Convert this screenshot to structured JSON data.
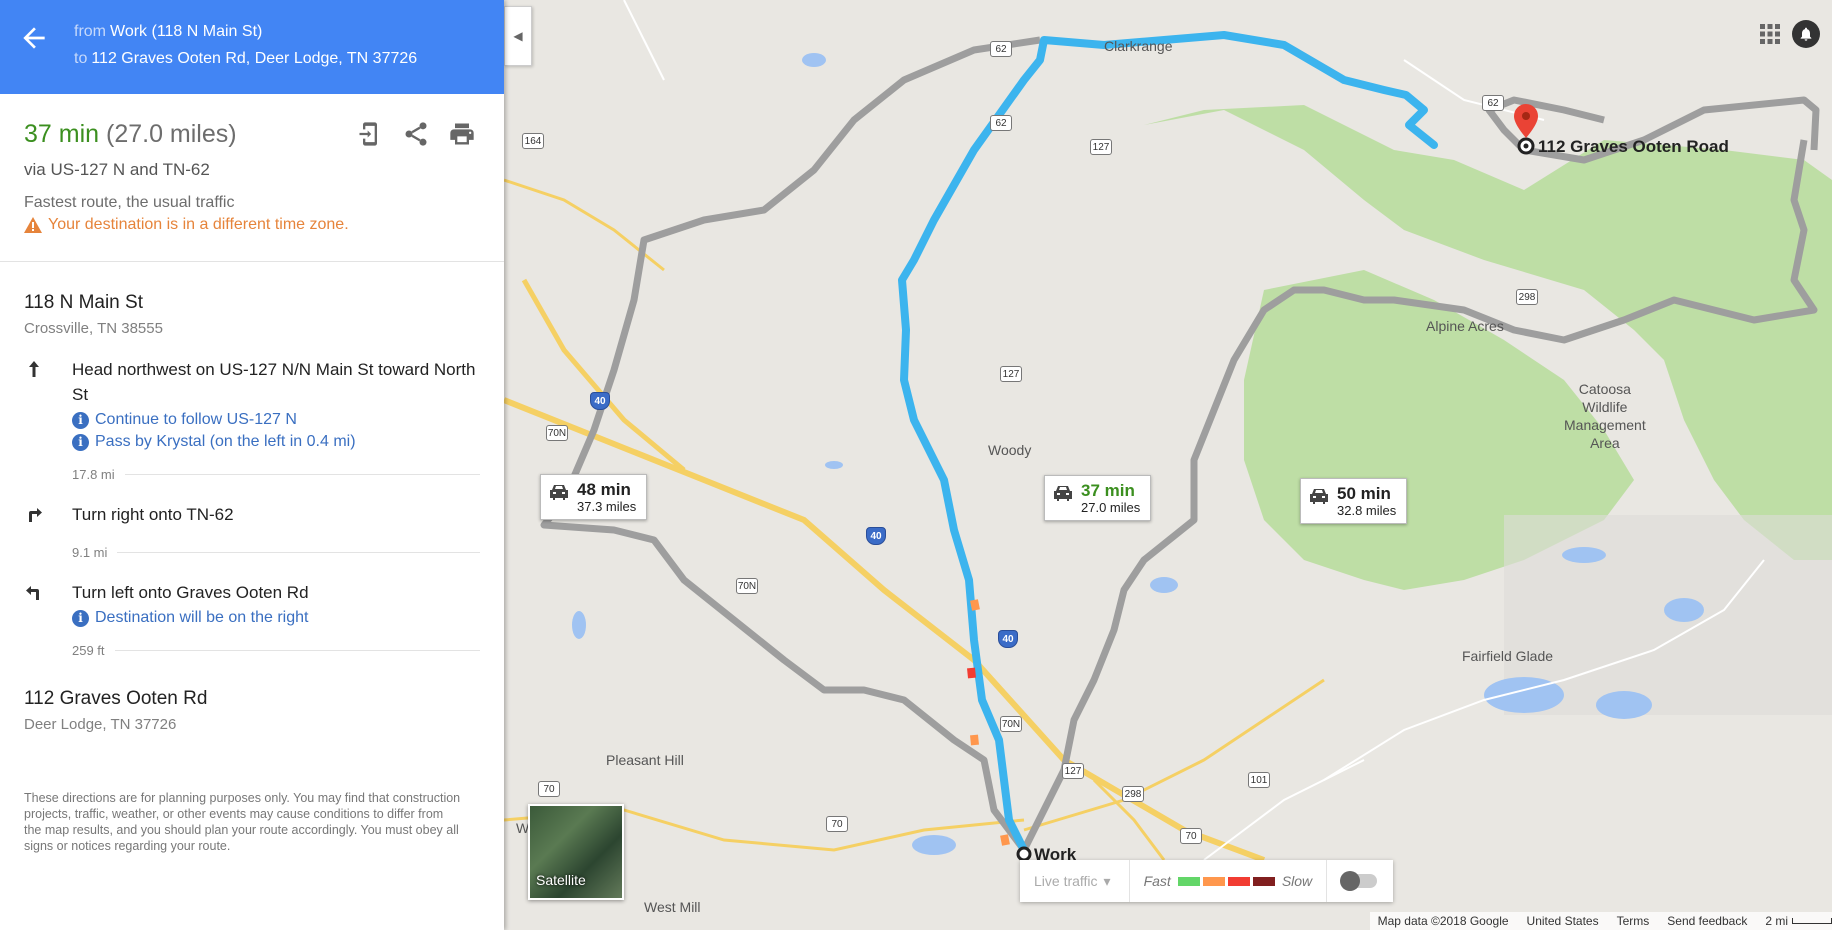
{
  "header": {
    "from_prefix": "from",
    "from_value": "Work (118 N Main St)",
    "to_prefix": "to",
    "to_value": "112 Graves Ooten Rd, Deer Lodge, TN 37726"
  },
  "summary": {
    "time": "37 min",
    "distance": "(27.0 miles)",
    "via": "via US-127 N and TN-62",
    "note": "Fastest route, the usual traffic",
    "warning": "Your destination is in a different time zone."
  },
  "origin": {
    "name": "118 N Main St",
    "address": "Crossville, TN 38555"
  },
  "steps": [
    {
      "icon": "arrow-up-icon",
      "text": "Head northwest on US-127 N/N Main St toward North St",
      "subs": [
        "Continue to follow US-127 N",
        "Pass by Krystal (on the left in 0.4 mi)"
      ],
      "distance": "17.8 mi"
    },
    {
      "icon": "turn-right-icon",
      "text": "Turn right onto TN-62",
      "subs": [],
      "distance": "9.1 mi"
    },
    {
      "icon": "turn-left-icon",
      "text": "Turn left onto Graves Ooten Rd",
      "subs": [
        "Destination will be on the right"
      ],
      "distance": "259 ft"
    }
  ],
  "destination": {
    "name": "112 Graves Ooten Rd",
    "address": "Deer Lodge, TN 37726"
  },
  "disclaimer": "These directions are for planning purposes only. You may find that construction projects, traffic, weather, or other events may cause conditions to differ from the map results, and you should plan your route accordingly. You must obey all signs or notices regarding your route.",
  "map": {
    "labels": {
      "clarkrange": "Clarkrange",
      "woody": "Woody",
      "alpine_acres": "Alpine Acres",
      "catoosa": "Catoosa\nWildlife\nManagement\nArea",
      "fairfield": "Fairfield Glade",
      "pleasant_hill": "Pleasant Hill",
      "west_mill": "West Mill",
      "w": "W",
      "work": "Work",
      "destination": "112 Graves Ooten Road"
    },
    "shields": [
      "62",
      "164",
      "62",
      "127",
      "127",
      "70N",
      "40",
      "40",
      "70N",
      "40",
      "70N",
      "127",
      "298",
      "298",
      "101",
      "70",
      "70",
      "70",
      "62"
    ],
    "routes": [
      {
        "time": "48 min",
        "distance": "37.3 miles"
      },
      {
        "time": "37 min",
        "distance": "27.0 miles"
      },
      {
        "time": "50 min",
        "distance": "32.8 miles"
      }
    ],
    "satellite_label": "Satellite",
    "traffic": {
      "live_label": "Live traffic",
      "fast_label": "Fast",
      "slow_label": "Slow",
      "colors": [
        "#63d668",
        "#ff974d",
        "#f23c32",
        "#811f1f"
      ]
    },
    "footer": {
      "data": "Map data ©2018 Google",
      "country": "United States",
      "terms": "Terms",
      "feedback": "Send feedback",
      "scale": "2 mi"
    }
  }
}
